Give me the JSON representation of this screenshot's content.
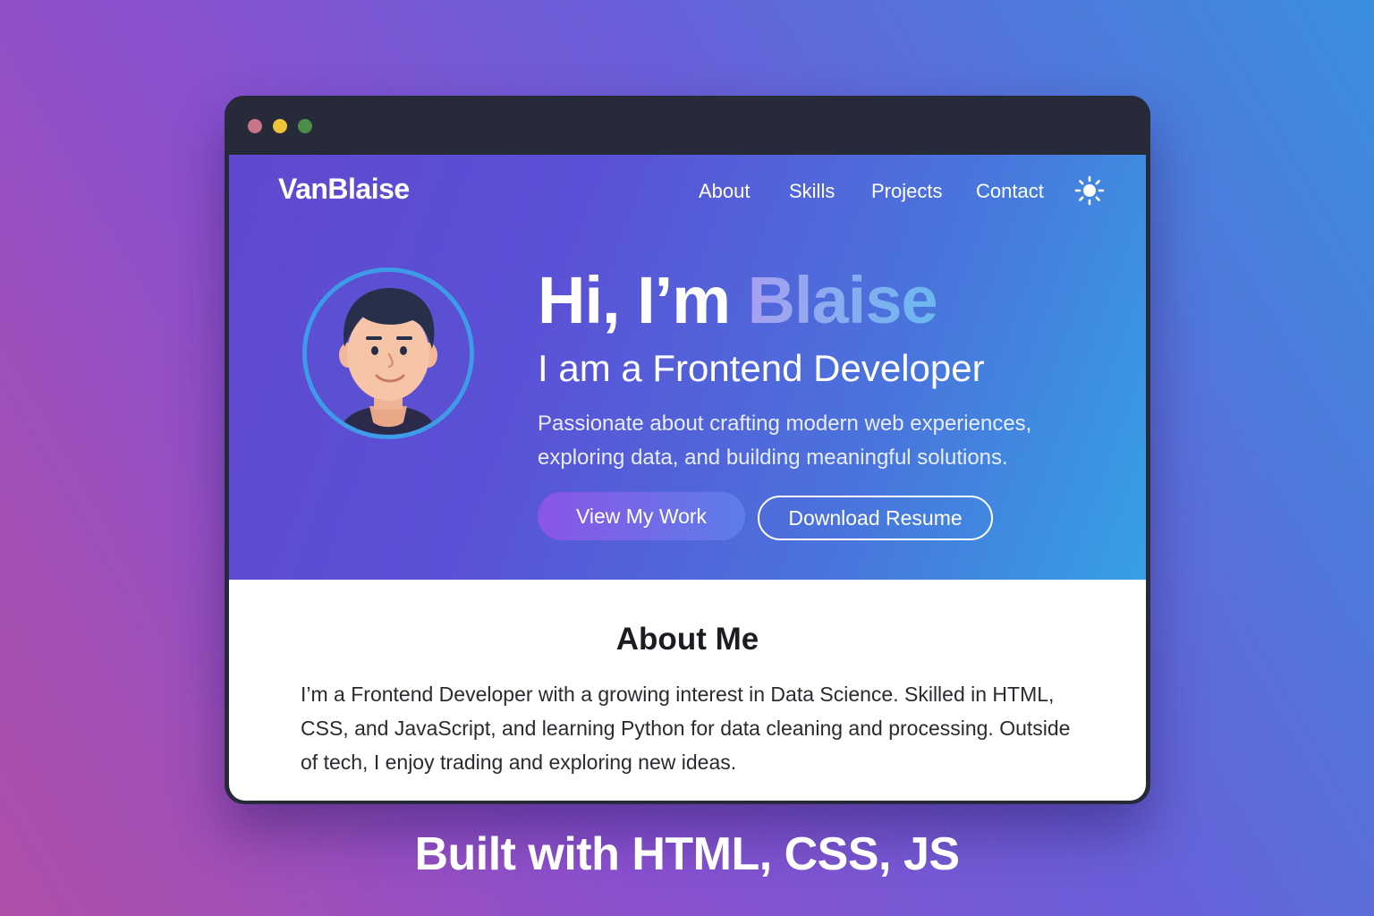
{
  "window": {
    "traffic_lights": [
      "close",
      "minimize",
      "maximize"
    ]
  },
  "site": {
    "brand": "VanBlaise",
    "nav": {
      "about": "About",
      "skills": "Skills",
      "projects": "Projects",
      "contact": "Contact",
      "theme_icon": "sun-icon"
    }
  },
  "hero": {
    "greeting": "Hi, I’m ",
    "name": "Blaise",
    "role": "I am a Frontend Developer",
    "tagline": "Passionate about crafting modern web experiences, exploring data, and building meaningful solutions.",
    "primary_button": "View My Work",
    "secondary_button": "Download Resume",
    "avatar_icon": "avatar-illustration"
  },
  "about": {
    "title": "About Me",
    "body": "I’m a Frontend Developer with a growing interest in Data Science. Skilled in HTML, CSS, and JavaScript, and learning Python for data cleaning and processing. Outside of tech, I enjoy trading and exploring new ideas."
  },
  "caption": "Built with HTML, CSS, JS",
  "colors": {
    "hero_gradient_start": "#6048cf",
    "hero_gradient_end": "#35a0e6",
    "window_frame": "#262a39",
    "accent_ring": "#3d9be8"
  }
}
